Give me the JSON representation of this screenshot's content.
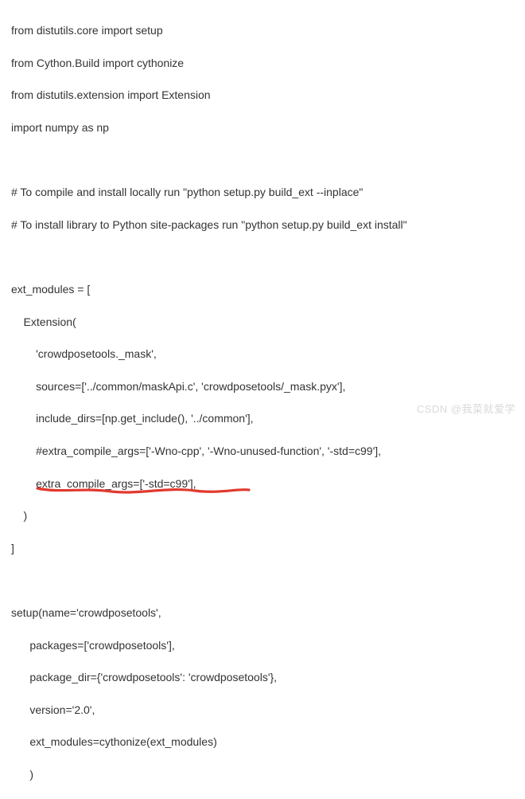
{
  "code": {
    "l1": "from distutils.core import setup",
    "l2": "from Cython.Build import cythonize",
    "l3": "from distutils.extension import Extension",
    "l4": "import numpy as np",
    "l5": "",
    "l6": "# To compile and install locally run \"python setup.py build_ext --inplace\"",
    "l7": "# To install library to Python site-packages run \"python setup.py build_ext install\"",
    "l8": "",
    "l9": "ext_modules = [",
    "l10": "    Extension(",
    "l11": "        'crowdposetools._mask',",
    "l12": "        sources=['../common/maskApi.c', 'crowdposetools/_mask.pyx'],",
    "l13": "        include_dirs=[np.get_include(), '../common'],",
    "l14": "        #extra_compile_args=['-Wno-cpp', '-Wno-unused-function', '-std=c99'],",
    "l15": "        extra_compile_args=['-std=c99'],",
    "l16": "    )",
    "l17": "]",
    "l18": "",
    "l19": "setup(name='crowdposetools',",
    "l20": "      packages=['crowdposetools'],",
    "l21": "      package_dir={'crowdposetools': 'crowdposetools'},",
    "l22": "      version='2.0',",
    "l23": "      ext_modules=cythonize(ext_modules)",
    "l24": "      )"
  },
  "highlight_color": "#e1392d",
  "watermark": "CSDN @我菜就爱学"
}
